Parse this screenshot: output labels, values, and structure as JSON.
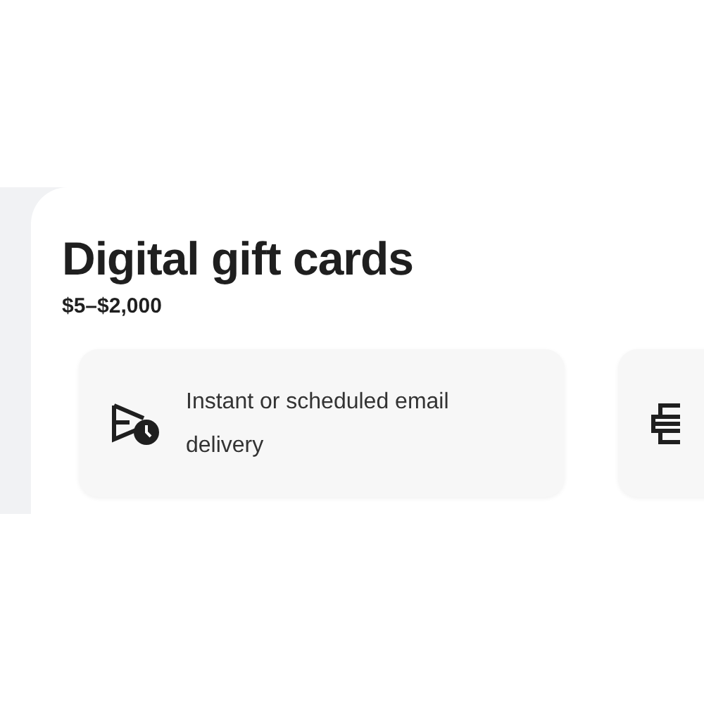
{
  "title": "Digital gift cards",
  "price_range": "$5–$2,000",
  "features": [
    {
      "kind": "delivery",
      "text": "Instant or scheduled email delivery"
    },
    {
      "kind": "design"
    }
  ]
}
